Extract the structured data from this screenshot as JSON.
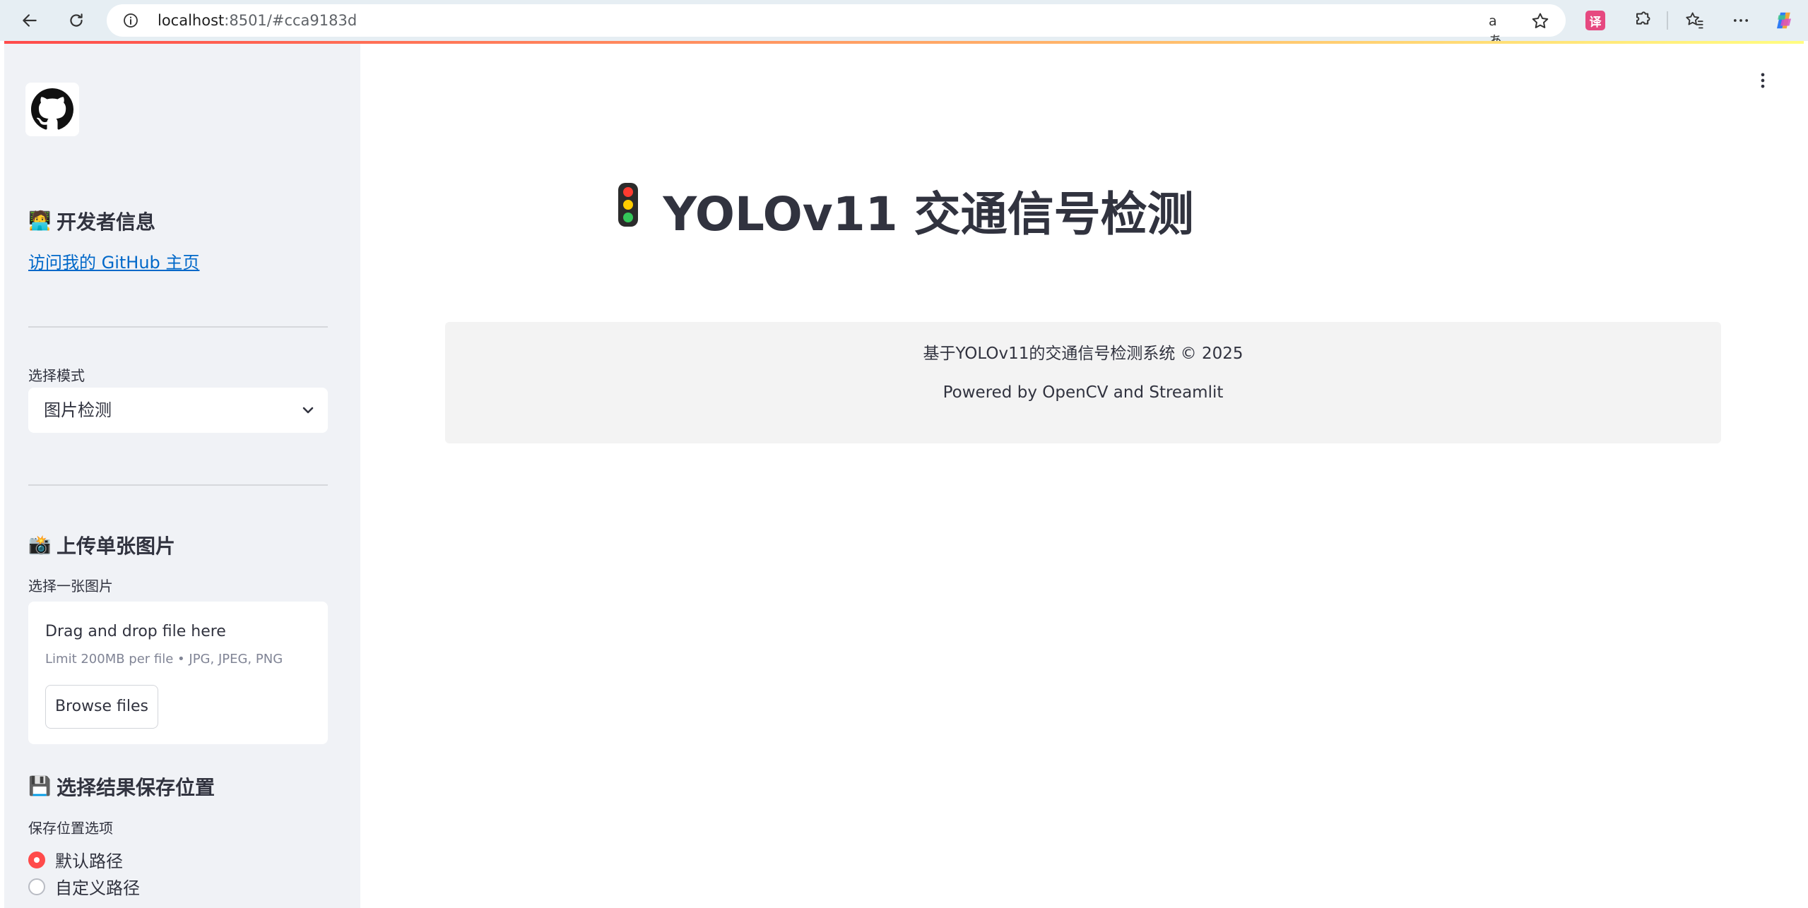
{
  "browser": {
    "url_host": "localhost",
    "url_rest": ":8501/#cca9183d",
    "icons": [
      "back-arrow-icon",
      "refresh-icon",
      "site-info-icon",
      "read-aloud-icon",
      "favorite-star-icon",
      "translate-extension-icon",
      "extensions-icon",
      "favorites-icon",
      "more-icon",
      "copilot-icon"
    ],
    "read_aloud_glyph": "aあ",
    "translate_glyph": "译"
  },
  "sidebar": {
    "developer_heading": "开发者信息",
    "developer_emoji": "🧑‍💻",
    "github_link": "访问我的 GitHub 主页",
    "mode_label": "选择模式",
    "mode_value": "图片检测",
    "upload_heading": "上传单张图片",
    "upload_emoji": "📸",
    "upload_label": "选择一张图片",
    "uploader": {
      "title": "Drag and drop file here",
      "limit": "Limit 200MB per file • JPG, JPEG, PNG",
      "button": "Browse files"
    },
    "save_heading": "选择结果保存位置",
    "save_emoji": "💾",
    "save_label": "保存位置选项",
    "save_options": [
      {
        "label": "默认路径",
        "selected": true
      },
      {
        "label": "自定义路径",
        "selected": false
      }
    ]
  },
  "main": {
    "title_emoji": "🚦",
    "title": "YOLOv11 交通信号检测",
    "footer_line1": "基于YOLOv11的交通信号检测系统 © 2025",
    "footer_line2": "Powered by OpenCV and Streamlit"
  },
  "colors": {
    "accent": "#ff4b4b",
    "link": "#0068c9",
    "sidebar_bg": "#f0f2f6",
    "text": "#31333f"
  }
}
